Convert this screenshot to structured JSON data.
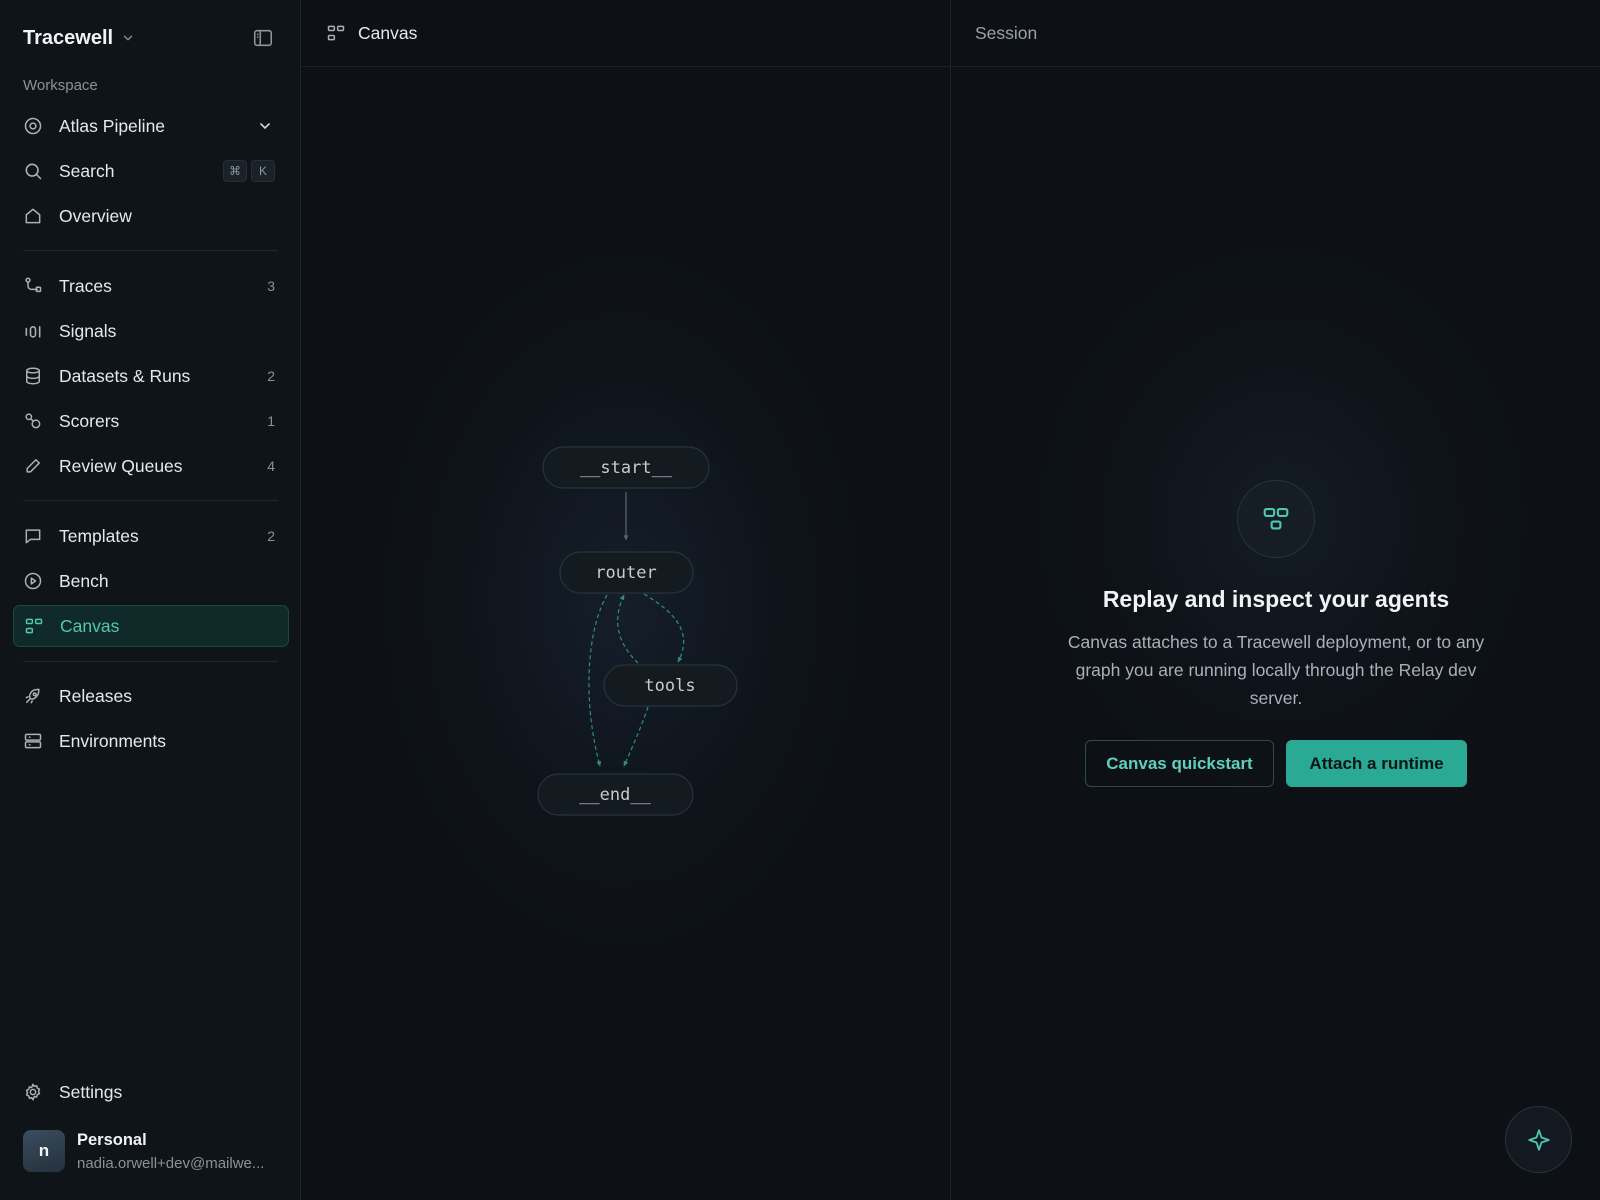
{
  "app": {
    "name": "Tracewell"
  },
  "sidebar": {
    "section_label": "Workspace",
    "workspace": {
      "label": "Atlas Pipeline",
      "icon": "target-icon"
    },
    "search": {
      "label": "Search",
      "shortcut": [
        "⌘",
        "K"
      ]
    },
    "overview": {
      "label": "Overview"
    },
    "groups": [
      [
        {
          "label": "Traces",
          "count": "3",
          "icon": "route-icon"
        },
        {
          "label": "Signals",
          "count": "",
          "icon": "bars-icon"
        },
        {
          "label": "Datasets & Runs",
          "count": "2",
          "icon": "database-icon"
        },
        {
          "label": "Scorers",
          "count": "1",
          "icon": "scorer-icon"
        },
        {
          "label": "Review Queues",
          "count": "4",
          "icon": "pencil-icon"
        }
      ],
      [
        {
          "label": "Templates",
          "count": "2",
          "icon": "chat-icon"
        },
        {
          "label": "Bench",
          "count": "",
          "icon": "play-circle-icon"
        },
        {
          "label": "Canvas",
          "count": "",
          "icon": "canvas-icon",
          "active": true
        }
      ],
      [
        {
          "label": "Releases",
          "count": "",
          "icon": "rocket-icon"
        },
        {
          "label": "Environments",
          "count": "",
          "icon": "server-icon"
        }
      ]
    ],
    "settings": {
      "label": "Settings"
    },
    "account": {
      "initial": "n",
      "name": "Personal",
      "email": "nadia.orwell+dev@mailwe..."
    }
  },
  "canvas": {
    "title": "Canvas",
    "nodes": [
      "__start__",
      "router",
      "tools",
      "__end__"
    ]
  },
  "session": {
    "title": "Session",
    "empty_title": "Replay and inspect your agents",
    "empty_description": "Canvas attaches to a Tracewell deployment, or to any graph you are running locally through the Relay dev server.",
    "secondary_button": "Canvas quickstart",
    "primary_button": "Attach a runtime"
  },
  "colors": {
    "accent": "#2aa994",
    "accent_text": "#4fc7b1",
    "background": "#0d1116",
    "sidebar": "#0f1419"
  }
}
